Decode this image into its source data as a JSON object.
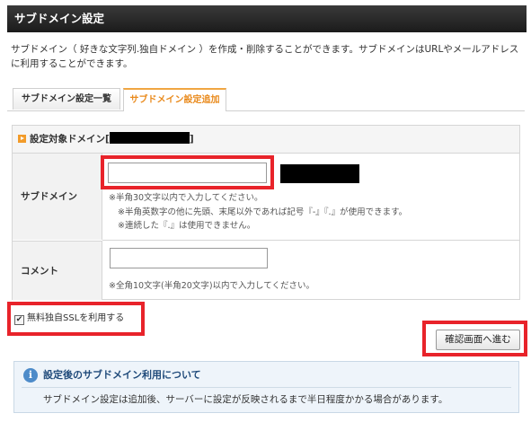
{
  "page": {
    "title": "サブドメイン設定",
    "description_line1": "サブドメイン（ 好きな文字列.独自ドメイン ）を作成・削除することができます。サブドメインはURLやメールアドレス",
    "description_line2": "に利用することができます。"
  },
  "tabs": [
    {
      "label": "サブドメイン設定一覧",
      "active": false
    },
    {
      "label": "サブドメイン設定追加",
      "active": true
    }
  ],
  "form": {
    "target_domain_prefix": "設定対象ドメイン[",
    "target_domain_suffix": "]",
    "subdomain": {
      "label": "サブドメイン",
      "value": "",
      "hint1": "※半角30文字以内で入力してください。",
      "hint2": "※半角英数字の他に先頭、末尾以外であれば記号『-』『.』が使用できます。",
      "hint3": "※連続した『.』は使用できません。"
    },
    "comment": {
      "label": "コメント",
      "value": "",
      "hint": "※全角10文字(半角20文字)以内で入力してください。"
    },
    "ssl_checkbox": {
      "label": "無料独自SSLを利用する",
      "checked": true
    },
    "confirm_button": "確認画面へ進む"
  },
  "info": {
    "title": "設定後のサブドメイン利用について",
    "text": "サブドメイン設定は追加後、サーバーに設定が反映されるまで半日程度かかる場合があります。"
  },
  "colors": {
    "header_bg": "#1b1b1b",
    "accent_orange": "#f29b29",
    "annotation_red": "#e8232a",
    "info_blue": "#4d8bc9"
  }
}
